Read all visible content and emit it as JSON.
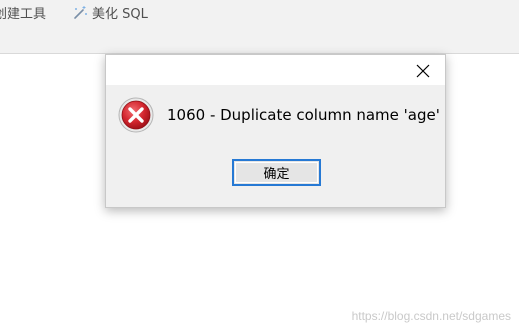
{
  "toolbar": {
    "create_tool_label": "创建工具",
    "beautify_label": "美化 SQL"
  },
  "dialog": {
    "message": "1060 - Duplicate column name 'age'",
    "ok_label": "确定",
    "icon": "error-icon",
    "close_icon": "close-icon"
  },
  "watermark": "https://blog.csdn.net/sdgames",
  "colors": {
    "button_focus_border": "#2679d4",
    "error_red": "#c8202a",
    "dialog_bg": "#f0f0f0",
    "toolbar_bg": "#f2f2f2"
  }
}
